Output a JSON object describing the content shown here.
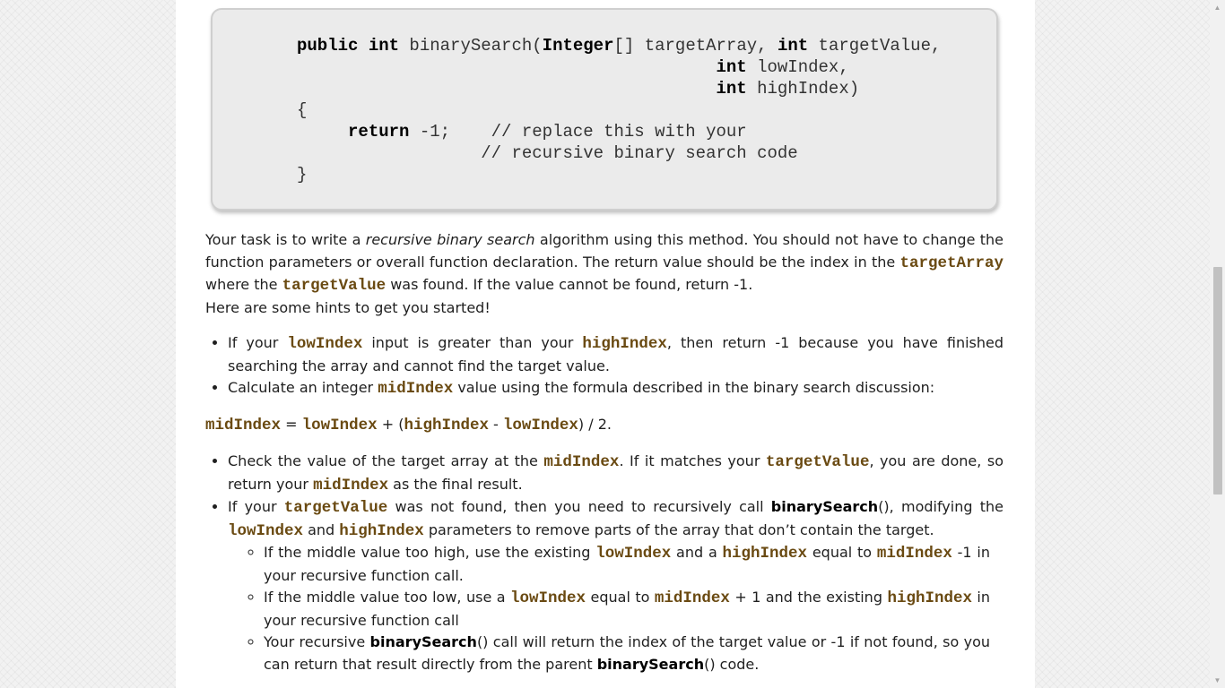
{
  "code": {
    "l1_kw1": "public int",
    "l1_fn": " binarySearch(",
    "l1_type": "Integer",
    "l1_rest": "[] targetArray, ",
    "l1_kw2": "int",
    "l1_end": " targetValue,",
    "l2_kw": "int",
    "l2_end": " lowIndex,",
    "l3_kw": "int",
    "l3_end": " highIndex)",
    "open_brace": "{",
    "ret_kw": "return",
    "ret_val": " -1;",
    "comment1": "// replace this with your",
    "comment2": "// recursive binary search code",
    "close_brace": "}"
  },
  "intro": {
    "t1": "Your task is to write a ",
    "em": "recursive binary search",
    "t2": " algorithm using this method.  You should not have to change the function parameters or overall function declaration.  The return value should be the index in the ",
    "c1": "targetArray",
    "t3": " where the ",
    "c2": "targetValue",
    "t4": " was found.  If the value cannot be found, return -1."
  },
  "hints_intro": "Here are some hints to get you started!",
  "bullets1": {
    "b1_t1": "If your ",
    "b1_c1": "lowIndex",
    "b1_t2": " input is greater than your ",
    "b1_c2": "highIndex",
    "b1_t3": ", then return -1 because you have finished searching the array and cannot find the target value.",
    "b2_t1": "Calculate an integer ",
    "b2_c1": "midIndex",
    "b2_t2": " value using the formula described in the binary search discussion:"
  },
  "formula": {
    "c1": "midIndex",
    "t1": " = ",
    "c2": "lowIndex",
    "t2": " + (",
    "c3": "highIndex",
    "t3": " - ",
    "c4": "lowIndex",
    "t4": ") / 2."
  },
  "bullets2": {
    "b3_t1": "Check the value of the target array at the ",
    "b3_c1": "midIndex",
    "b3_t2": ".  If it matches your ",
    "b3_c2": "targetValue",
    "b3_t3": ", you are done, so return your ",
    "b3_c3": "midIndex",
    "b3_t4": " as the final result.",
    "b4_t1": "If your ",
    "b4_c1": "targetValue",
    "b4_t2": " was not found, then you need to recursively call ",
    "b4_b1": "binarySearch",
    "b4_t3": "(), modifying the ",
    "b4_c2": "lowIndex",
    "b4_t4": " and ",
    "b4_c3": "highIndex",
    "b4_t5": " parameters to remove parts of the array that don’t contain the target."
  },
  "sub": {
    "s1_t1": "If the middle value too high, use the existing ",
    "s1_c1": "lowIndex",
    "s1_t2": " and a ",
    "s1_c2": "highIndex",
    "s1_t3": " equal to ",
    "s1_c3": "midIndex",
    "s1_t4": " -1 in your recursive function call.",
    "s2_t1": "If the middle value too low, use a ",
    "s2_c1": "lowIndex",
    "s2_t2": " equal to ",
    "s2_c2": "midIndex",
    "s2_t3": " + 1 and the existing ",
    "s2_c3": "highIndex",
    "s2_t4": " in your recursive function call",
    "s3_t1": "Your recursive ",
    "s3_b1": "binarySearch",
    "s3_t2": "() call will return the index of the target value or -1 if not found, so you can return that result directly from the parent ",
    "s3_b2": "binarySearch",
    "s3_t3": "() code."
  },
  "scrollbar": {
    "up_icon": "triangle-up",
    "down_icon": "triangle-down",
    "position": 0.44
  }
}
